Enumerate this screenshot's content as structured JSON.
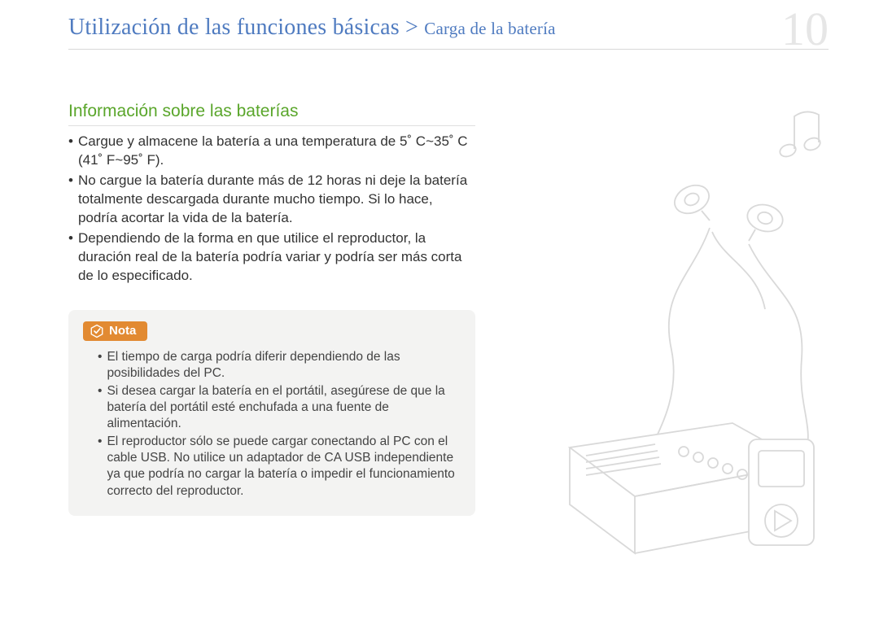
{
  "header": {
    "breadcrumb_main": "Utilización de las funciones básicas",
    "breadcrumb_sep": " > ",
    "breadcrumb_sub": "Carga de la batería",
    "page_number": "10"
  },
  "section": {
    "title": "Información sobre las baterías",
    "bullets": [
      "Cargue y almacene la batería a una temperatura de 5˚ C~35˚ C (41˚ F~95˚ F).",
      "No cargue la batería durante más de 12 horas ni deje la batería totalmente descargada durante mucho tiempo. Si lo hace, podría acortar la vida de la batería.",
      "Dependiendo de la forma en que utilice el reproductor, la duración real de la batería podría variar y podría ser más corta de lo especificado."
    ]
  },
  "note": {
    "label": "Nota",
    "bullets": [
      "El tiempo de carga podría diferir dependiendo de las posibilidades del PC.",
      "Si desea cargar la batería en el portátil, asegúrese de que la batería del portátil esté enchufada a una fuente de alimentación.",
      "El reproductor sólo se puede cargar conectando al PC con el cable USB. No utilice un adaptador de CA USB independiente ya que podría no cargar la batería o impedir el funcionamiento correcto del reproductor."
    ]
  }
}
